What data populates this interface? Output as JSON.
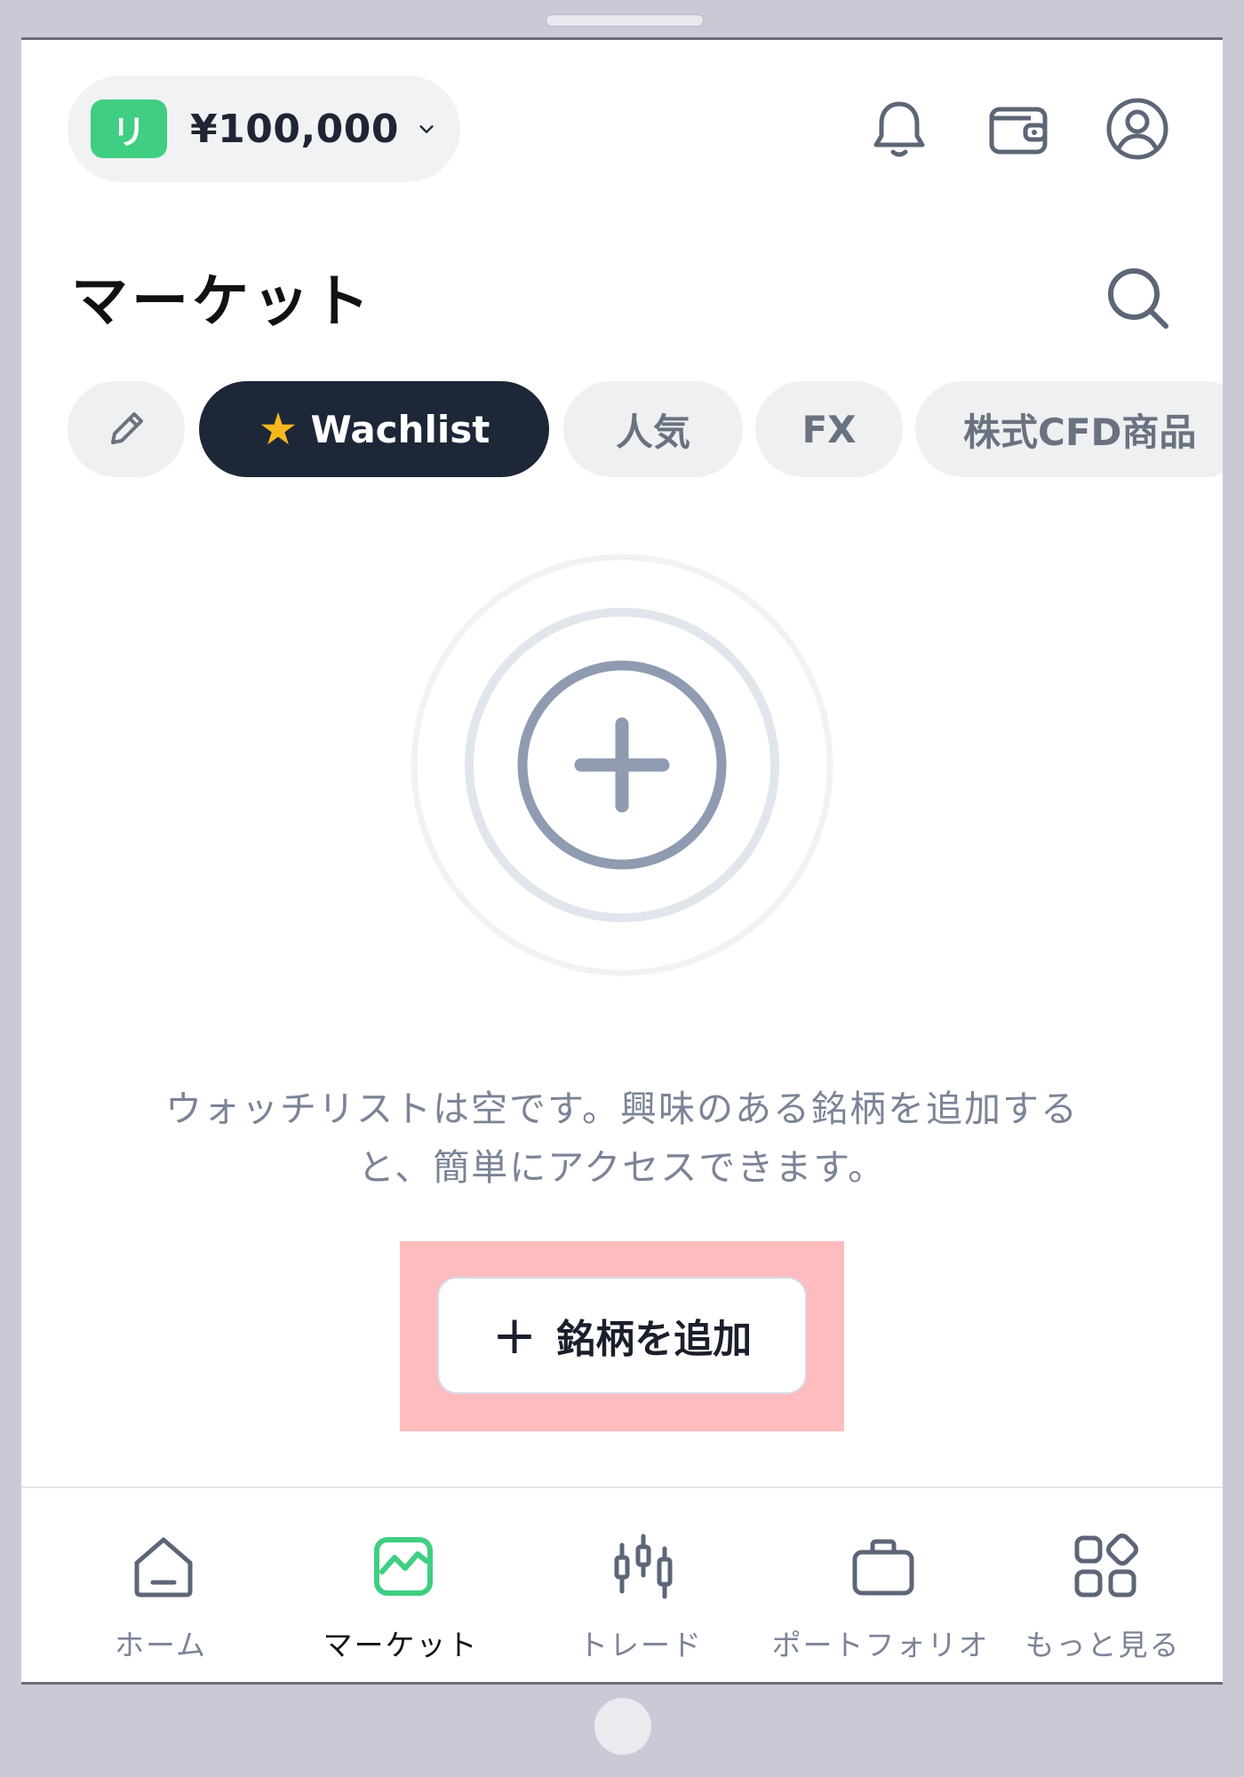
{
  "header": {
    "account_badge": "リ",
    "balance": "¥100,000"
  },
  "page": {
    "title": "マーケット"
  },
  "tabs": [
    {
      "label": "Wachlist",
      "icon": "star-icon",
      "active": true
    },
    {
      "label": "人気",
      "active": false
    },
    {
      "label": "FX",
      "active": false
    },
    {
      "label": "株式CFD商品",
      "active": false
    }
  ],
  "empty_state": {
    "message_line1": "ウォッチリストは空です。興味のある銘柄を追加する",
    "message_line2": "と、簡単にアクセスできます。",
    "add_button_label": "銘柄を追加"
  },
  "nav": [
    {
      "label": "ホーム",
      "icon": "home-icon"
    },
    {
      "label": "マーケット",
      "icon": "chart-icon",
      "active": true
    },
    {
      "label": "トレード",
      "icon": "candlestick-icon"
    },
    {
      "label": "ポートフォリオ",
      "icon": "briefcase-icon"
    },
    {
      "label": "もっと見る",
      "icon": "more-apps-icon"
    }
  ],
  "colors": {
    "accent_green": "#3fce82",
    "active_chip": "#1e2738",
    "highlight": "#ffbcbf"
  }
}
